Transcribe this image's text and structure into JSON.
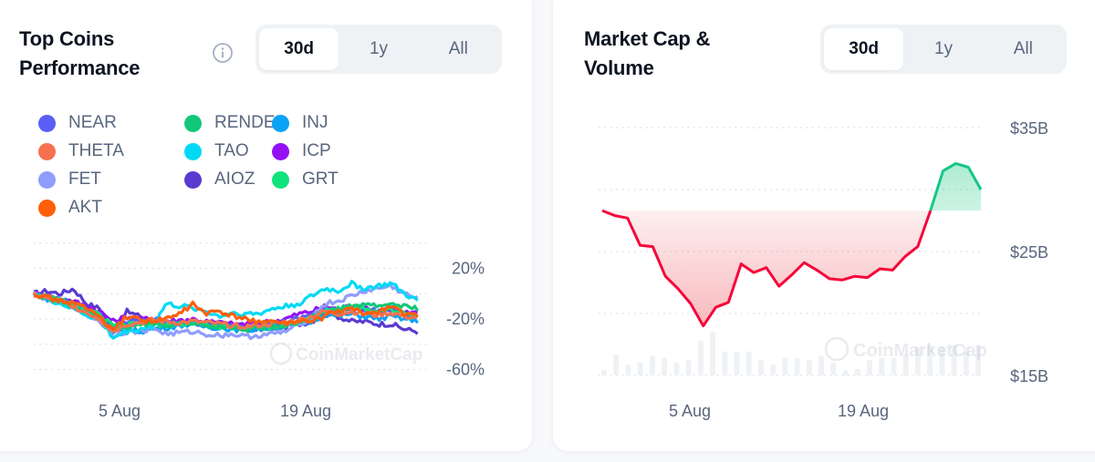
{
  "left_card": {
    "title_line1": "Top Coins",
    "title_line2": "Performance",
    "info_icon": "info-circle-icon",
    "range_tabs": [
      {
        "label": "30d",
        "active": true
      },
      {
        "label": "1y",
        "active": false
      },
      {
        "label": "All",
        "active": false
      }
    ]
  },
  "right_card": {
    "title_line1": "Market Cap &",
    "title_line2": "Volume",
    "range_tabs": [
      {
        "label": "30d",
        "active": true
      },
      {
        "label": "1y",
        "active": false
      },
      {
        "label": "All",
        "active": false
      }
    ]
  },
  "colors": {
    "up": "#16c784",
    "down": "#ea3943",
    "grid": "#d6dbe3",
    "volume": "#eff2f5",
    "axis_text": "#58667e"
  },
  "chart_data": [
    {
      "type": "line",
      "title": "Top Coins Performance",
      "xlabel": "",
      "ylabel": "",
      "y_unit": "%",
      "ylim": [
        -80,
        40
      ],
      "y_ticks": [
        "20%",
        "-20%",
        "-60%"
      ],
      "y_tick_values": [
        20,
        -20,
        -60
      ],
      "x_ticks": [
        "5 Aug",
        "19 Aug"
      ],
      "x_tick_days": [
        6,
        20
      ],
      "x_range_days": [
        0,
        31
      ],
      "grid": true,
      "legend_position": "top-left",
      "watermark": "CoinMarketCap",
      "series": [
        {
          "name": "NEAR",
          "color": "#5b5ef5",
          "values": [
            0,
            -3,
            -5,
            -8,
            -14,
            -18,
            -26,
            -22,
            -22,
            -20,
            -22,
            -24,
            -23,
            -24,
            -25,
            -26,
            -27,
            -25,
            -24,
            -22,
            -20,
            -16,
            -12,
            -14,
            -10,
            -12,
            -14,
            -12,
            -16,
            -18
          ]
        },
        {
          "name": "THETA",
          "color": "#f6714f",
          "values": [
            0,
            -4,
            -6,
            -10,
            -15,
            -20,
            -30,
            -24,
            -23,
            -21,
            -22,
            -23,
            -22,
            -23,
            -24,
            -25,
            -26,
            -25,
            -24,
            -23,
            -21,
            -18,
            -14,
            -16,
            -14,
            -16,
            -17,
            -15,
            -18,
            -19
          ]
        },
        {
          "name": "FET",
          "color": "#8f9dfc",
          "values": [
            0,
            -4,
            -6,
            -10,
            -16,
            -22,
            -33,
            -30,
            -30,
            -27,
            -32,
            -31,
            -30,
            -32,
            -33,
            -32,
            -34,
            -33,
            -32,
            -30,
            -25,
            -18,
            -8,
            -6,
            -2,
            2,
            4,
            6,
            0,
            -4
          ]
        },
        {
          "name": "AKT",
          "color": "#ff5f0b",
          "values": [
            0,
            -3,
            -6,
            -7,
            -12,
            -18,
            -30,
            -18,
            -20,
            -22,
            -20,
            -16,
            -8,
            -16,
            -14,
            -18,
            -20,
            -22,
            -22,
            -24,
            -22,
            -22,
            -18,
            -14,
            -12,
            -16,
            -14,
            -10,
            -16,
            -18
          ]
        },
        {
          "name": "RENDER",
          "color": "#12c77a",
          "values": [
            0,
            -3,
            -6,
            -10,
            -14,
            -18,
            -28,
            -26,
            -25,
            -24,
            -25,
            -24,
            -23,
            -25,
            -26,
            -27,
            -28,
            -27,
            -26,
            -25,
            -22,
            -19,
            -14,
            -12,
            -10,
            -8,
            -10,
            -8,
            -10,
            -12
          ]
        },
        {
          "name": "TAO",
          "color": "#00d9f5",
          "values": [
            0,
            -4,
            -8,
            -12,
            -17,
            -21,
            -35,
            -30,
            -28,
            -26,
            -8,
            -10,
            -11,
            -14,
            -18,
            -15,
            -16,
            -16,
            -12,
            -10,
            -8,
            -2,
            4,
            2,
            8,
            4,
            6,
            8,
            0,
            -6
          ]
        },
        {
          "name": "AIOZ",
          "color": "#5a3ad0",
          "values": [
            0,
            2,
            0,
            4,
            -8,
            -12,
            -28,
            -14,
            -18,
            -22,
            -24,
            -24,
            -23,
            -24,
            -25,
            -26,
            -28,
            -28,
            -27,
            -26,
            -24,
            -22,
            -14,
            -18,
            -22,
            -22,
            -24,
            -24,
            -28,
            -30
          ]
        },
        {
          "name": "INJ",
          "color": "#0aa2f7",
          "values": [
            0,
            -4,
            -7,
            -11,
            -16,
            -20,
            -32,
            -28,
            -30,
            -28,
            -27,
            -25,
            -24,
            -26,
            -27,
            -28,
            -29,
            -28,
            -27,
            -26,
            -24,
            -22,
            -16,
            -18,
            -16,
            -18,
            -20,
            -18,
            -20,
            -22
          ]
        },
        {
          "name": "ICP",
          "color": "#9510f5",
          "values": [
            0,
            -2,
            -4,
            -6,
            -10,
            -14,
            -22,
            -18,
            -20,
            -20,
            -22,
            -21,
            -20,
            -22,
            -23,
            -24,
            -24,
            -23,
            -22,
            -20,
            -16,
            -14,
            -10,
            -12,
            -10,
            -12,
            -13,
            -12,
            -15,
            -16
          ]
        },
        {
          "name": "GRT",
          "color": "#0ee37c",
          "values": [
            0,
            -3,
            -5,
            -9,
            -13,
            -17,
            -26,
            -25,
            -24,
            -24,
            -25,
            -24,
            -24,
            -25,
            -26,
            -27,
            -27,
            -26,
            -26,
            -25,
            -22,
            -20,
            -14,
            -12,
            -10,
            -12,
            -14,
            -12,
            -16,
            -18
          ]
        }
      ]
    },
    {
      "type": "area",
      "title": "Market Cap & Volume",
      "xlabel": "",
      "ylabel": "",
      "y_unit": "B USD",
      "ylim": [
        15,
        35
      ],
      "y_ticks": [
        "$35B",
        "$25B",
        "$15B"
      ],
      "y_tick_values": [
        35,
        25,
        15
      ],
      "x_ticks": [
        "5 Aug",
        "19 Aug"
      ],
      "x_tick_days": [
        6,
        20
      ],
      "x_range_days": [
        0,
        31
      ],
      "baseline": 28.3,
      "grid": true,
      "watermark": "CoinMarketCap",
      "series": [
        {
          "name": "Market Cap",
          "values": [
            28.3,
            27.9,
            27.7,
            25.5,
            25.4,
            23.0,
            22.0,
            20.8,
            19.0,
            20.5,
            20.9,
            24.0,
            23.3,
            23.7,
            22.2,
            23.1,
            24.1,
            23.5,
            22.8,
            22.7,
            23.0,
            22.9,
            23.6,
            23.5,
            24.6,
            25.4,
            28.3,
            31.5,
            32.1,
            31.8,
            30.0
          ]
        },
        {
          "name": "Volume",
          "relative_values": [
            0.12,
            0.48,
            0.25,
            0.3,
            0.45,
            0.4,
            0.3,
            0.35,
            0.8,
            1.0,
            0.55,
            0.55,
            0.55,
            0.35,
            0.25,
            0.4,
            0.4,
            0.35,
            0.45,
            0.3,
            0.12,
            0.15,
            0.35,
            0.4,
            0.4,
            0.48,
            0.65,
            0.7,
            0.65,
            0.7,
            0.65,
            0.7
          ]
        }
      ]
    }
  ]
}
